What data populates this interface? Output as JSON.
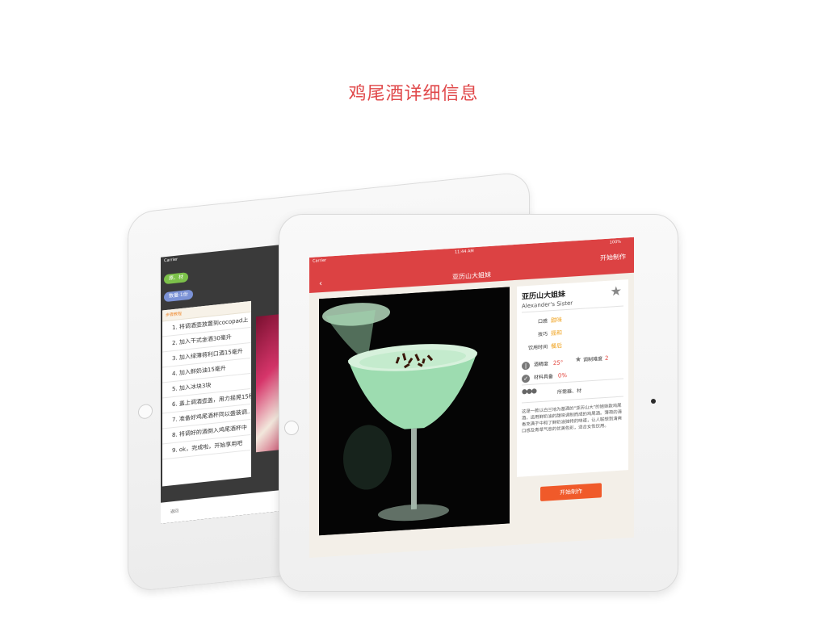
{
  "page": {
    "title": "鸡尾酒详细信息"
  },
  "back_ipad": {
    "status": "Carrier",
    "tag_materials": "原、材",
    "tag_quantity": "数量·1份",
    "card_header": "步骤教程",
    "steps": [
      "1. 将调酒壶放置到cocopad上",
      "2. 加入干式金酒30毫升",
      "3. 加入绿薄荷利口酒15毫升",
      "4. 加入鲜奶油15毫升",
      "5. 加入冰块3块",
      "6. 盖上调酒壶盖，用力摇晃15秒",
      "7. 准备好鸡尾酒杯同以盛装调...",
      "8. 将调好的酒倒入鸡尾酒杯中",
      "9. ok，完成啦，开始享用吧"
    ],
    "footer": "返回"
  },
  "front_ipad": {
    "status": {
      "carrier": "Carrier",
      "time": "11:44 AM",
      "battery": "100%"
    },
    "nav_title": "亚历山大姐妹",
    "start_top": "开始制作",
    "drink": {
      "cn_name": "亚历山大姐妹",
      "en_name": "Alexander's Sister",
      "taste_label": "口感",
      "taste_value": "甜味",
      "technique_label": "技巧",
      "technique_value": "摇和",
      "time_label": "饮用时间",
      "time_value": "餐后",
      "abv_label": "酒精度",
      "abv_value": "25°",
      "difficulty_label": "调制难度",
      "difficulty_value": "2",
      "ingredients_label": "材料具备",
      "ingredients_value": "0%",
      "tools_label": "所需器、材",
      "description": "这是一款以白兰地为基酒的\"亚历山大\"的姐妹款鸡尾酒，运用鲜奶油的甜味调制而成的鸡尾酒。薄荷的清香充满于中和了鲜奶油独特的味道，让人联想到清爽口感及青草气息的优美色彩，适合女性饮用。"
    },
    "start_button": "开始制作"
  }
}
